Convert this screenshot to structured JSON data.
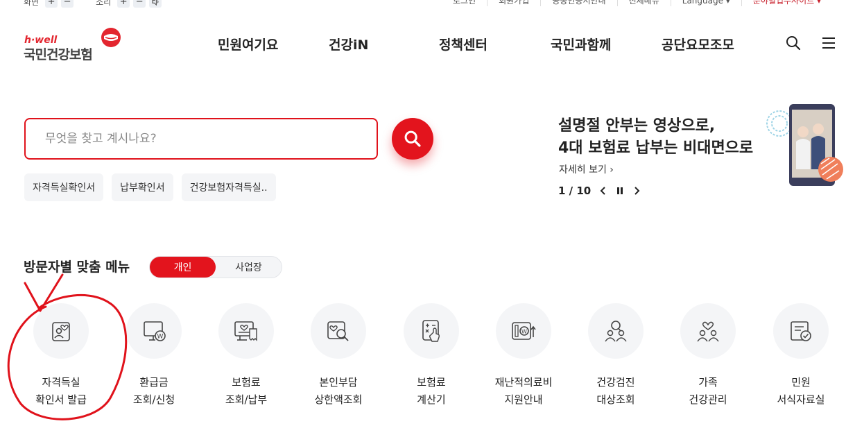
{
  "util": {
    "screen_label": "화면",
    "sound_label": "소리",
    "plus": "+",
    "minus": "−",
    "links": [
      "로그인",
      "회원가입",
      "공동인증서안내",
      "전체메뉴",
      "Language ▾",
      "분야별업무사이트 ▾"
    ]
  },
  "logo": {
    "tagline": "h·well",
    "name": "국민건강보험"
  },
  "gnb": [
    "민원여기요",
    "건강iN",
    "정책센터",
    "국민과함께",
    "공단요모조모"
  ],
  "search": {
    "placeholder": "무엇을 찾고 계시나요?",
    "value": ""
  },
  "chips": [
    "자격득실확인서",
    "납부확인서",
    "건강보험자격득실.."
  ],
  "banner": {
    "title_line1": "설명절 안부는 영상으로,",
    "title_line2": "4대 보험료 납부는 비대면으로",
    "more": "자세히 보기 ›",
    "page": "1 / 10"
  },
  "visitor_menu": {
    "title": "방문자별 맞춤 메뉴",
    "tabs": [
      "개인",
      "사업장"
    ],
    "active_tab": "개인",
    "items": [
      {
        "label": "자격득실\n확인서 발급",
        "icon": "id-card-heart-icon"
      },
      {
        "label": "환급금\n조회/신청",
        "icon": "monitor-won-icon"
      },
      {
        "label": "보험료\n조회/납부",
        "icon": "receipt-heart-icon"
      },
      {
        "label": "본인부담\n상한액조회",
        "icon": "search-heart-icon"
      },
      {
        "label": "보험료\n계산기",
        "icon": "calculator-hand-icon"
      },
      {
        "label": "재난적의료비\n지원안내",
        "icon": "won-support-icon"
      },
      {
        "label": "건강검진\n대상조회",
        "icon": "people-search-icon"
      },
      {
        "label": "가족\n건강관리",
        "icon": "family-heart-icon"
      },
      {
        "label": "민원\n서식자료실",
        "icon": "document-check-icon"
      }
    ]
  },
  "colors": {
    "brand_red": "#e3141d",
    "annotation_red": "#e0121b"
  }
}
